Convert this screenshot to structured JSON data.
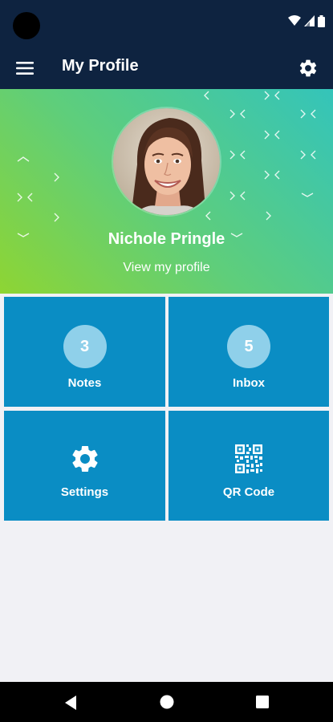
{
  "appbar": {
    "title": "My Profile",
    "menu_icon": "hamburger-menu-icon",
    "settings_icon": "gear-icon"
  },
  "profile": {
    "name": "Nichole Pringle",
    "link_label": "View my profile"
  },
  "tiles": [
    {
      "label": "Notes",
      "badge": "3"
    },
    {
      "label": "Inbox",
      "badge": "5"
    },
    {
      "label": "Settings",
      "icon": "gear-icon"
    },
    {
      "label": "QR Code",
      "icon": "qr-code-icon"
    }
  ],
  "colors": {
    "header": "#0e2340",
    "tile": "#0a8dc4",
    "badge": "#8fd0ea",
    "gradient_start": "#8ed533",
    "gradient_end": "#34c4ba",
    "background": "#f1f1f5"
  }
}
